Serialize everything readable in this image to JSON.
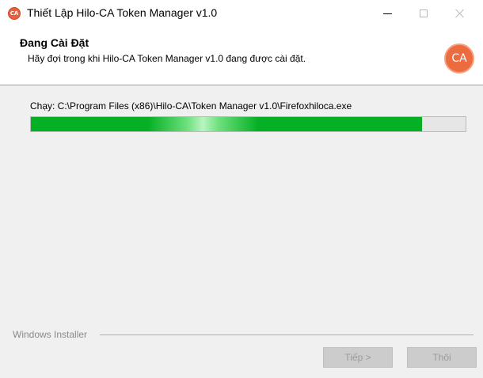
{
  "window": {
    "title": "Thiết Lập Hilo-CA Token Manager v1.0",
    "icon": "hiloca-logo-icon",
    "app_icon_text": "CA"
  },
  "header": {
    "title": "Đang Cài Đặt",
    "subtitle": "Hãy đợi trong khi Hilo-CA Token Manager v1.0 đang được cài đặt.",
    "logo_text": "CA",
    "logo_color": "#ec6b3f"
  },
  "progress": {
    "status_text": "Chạy: C:\\Program Files (x86)\\Hilo-CA\\Token Manager v1.0\\Firefoxhiloca.exe",
    "percent": 90,
    "fill_color": "#06b025"
  },
  "footer": {
    "group_label": "Windows Installer",
    "next_label": "Tiếp >",
    "cancel_label": "Thôi"
  }
}
